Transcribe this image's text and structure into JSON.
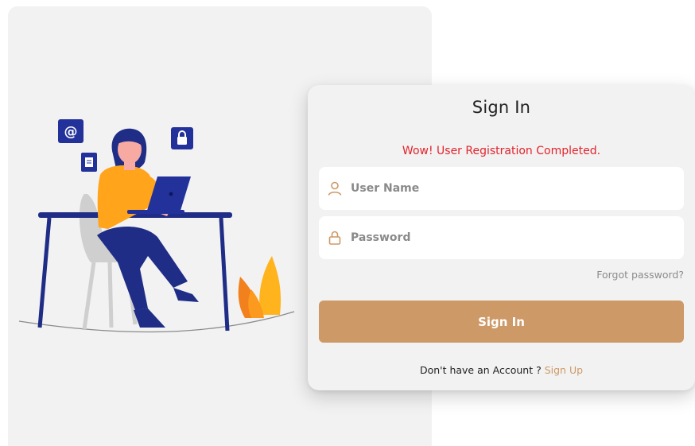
{
  "form": {
    "title": "Sign In",
    "message": "Wow! User Registration Completed.",
    "username_placeholder": "User Name",
    "password_placeholder": "Password",
    "forgot_label": "Forgot password?",
    "submit_label": "Sign In",
    "signup_prompt": "Don't have an Account ?",
    "signup_label": "Sign Up"
  },
  "icons": {
    "username": "user-icon",
    "password": "lock-icon",
    "floating": [
      "at-sign-icon",
      "document-icon",
      "padlock-icon"
    ]
  },
  "colors": {
    "accent": "#cd9966",
    "message": "#e4232b",
    "panel": "#f2f2f2",
    "illustration_navy": "#1f2d86",
    "illustration_orange": "#ffa41b"
  }
}
